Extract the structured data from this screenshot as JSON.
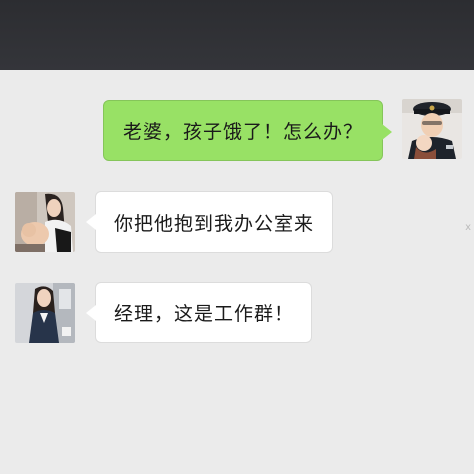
{
  "messages": [
    {
      "sender": "self",
      "avatar_icon": "police-man-holding-baby-avatar",
      "text": "老婆，孩子饿了！怎么办？"
    },
    {
      "sender": "other",
      "avatar_icon": "woman-holding-baby-avatar",
      "text": "你把他抱到我办公室来"
    },
    {
      "sender": "other",
      "avatar_icon": "office-woman-avatar",
      "text": "经理，这是工作群！"
    }
  ],
  "corner_mark": "x",
  "colors": {
    "top_bar": "#2e2f33",
    "chat_background": "#ebebeb",
    "outgoing_bubble": "#98e165",
    "incoming_bubble": "#ffffff"
  }
}
